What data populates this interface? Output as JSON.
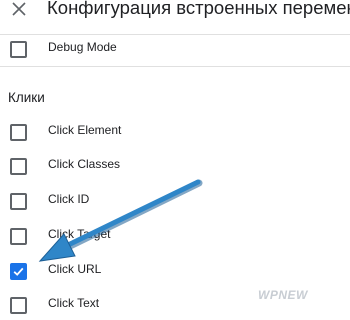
{
  "header": {
    "title": "Конфигурация встроенных переменн",
    "close_icon": "close-icon"
  },
  "top_items": [
    {
      "label": "Debug Mode",
      "checked": false
    }
  ],
  "section": {
    "title": "Клики",
    "items": [
      {
        "label": "Click Element",
        "checked": false
      },
      {
        "label": "Click Classes",
        "checked": false
      },
      {
        "label": "Click ID",
        "checked": false
      },
      {
        "label": "Click Target",
        "checked": false
      },
      {
        "label": "Click URL",
        "checked": true
      },
      {
        "label": "Click Text",
        "checked": false
      }
    ]
  },
  "annotation": {
    "arrow_icon": "pointer-arrow-icon",
    "color": "#2f86c8"
  },
  "watermark": {
    "text": "WPNEW"
  },
  "colors": {
    "accent": "#1a73e8",
    "checkbox_border": "#5f6368",
    "divider": "#e0e0e0"
  }
}
